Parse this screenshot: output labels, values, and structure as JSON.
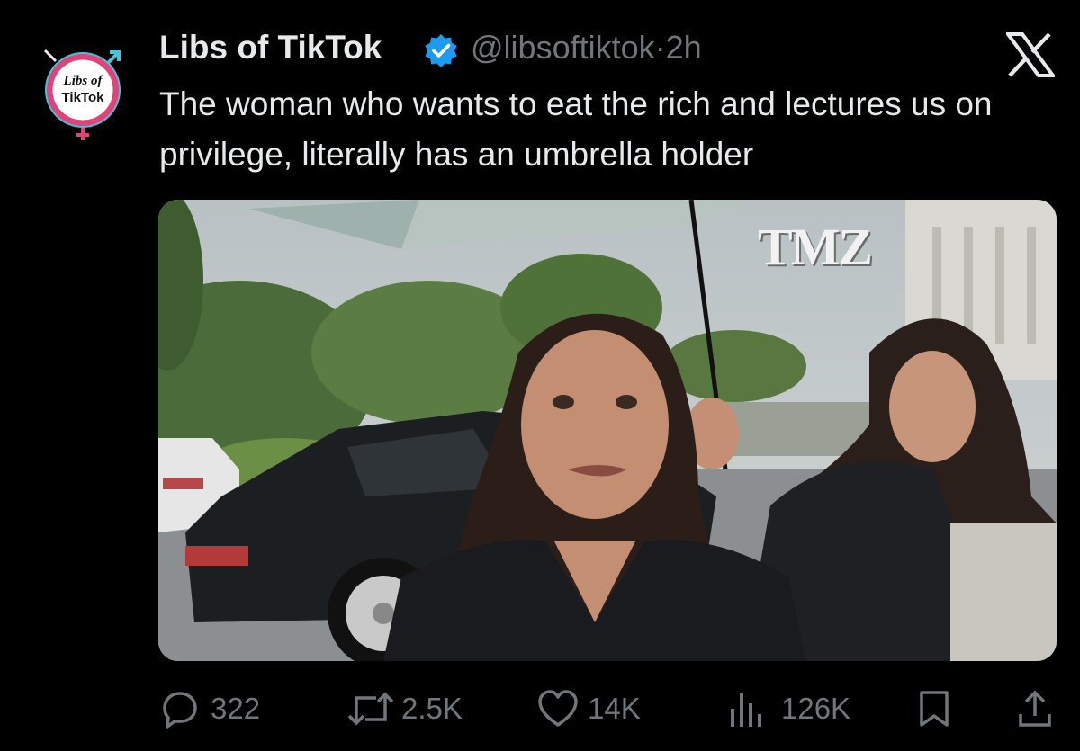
{
  "author": {
    "display_name": "Libs of TikTok",
    "handle": "@libsoftiktok",
    "separator": "·",
    "time": "2h",
    "avatar_text_line1": "Libs of",
    "avatar_text_line2": "TikTok"
  },
  "tweet": {
    "text": "The woman who wants to eat the rich and lectures us on privilege, literally has an umbrella holder"
  },
  "media": {
    "watermark": "TMZ"
  },
  "actions": {
    "replies": "322",
    "reposts": "2.5K",
    "likes": "14K",
    "views": "126K"
  },
  "icons": {
    "reply": "reply-icon",
    "repost": "repost-icon",
    "like": "heart-icon",
    "views": "views-icon",
    "bookmark": "bookmark-icon",
    "share": "share-icon",
    "close": "x-logo-icon",
    "verified": "verified-badge-icon"
  },
  "colors": {
    "background": "#000000",
    "text": "#e7e9ea",
    "secondary": "#71767b",
    "verified": "#1d9bf0"
  }
}
